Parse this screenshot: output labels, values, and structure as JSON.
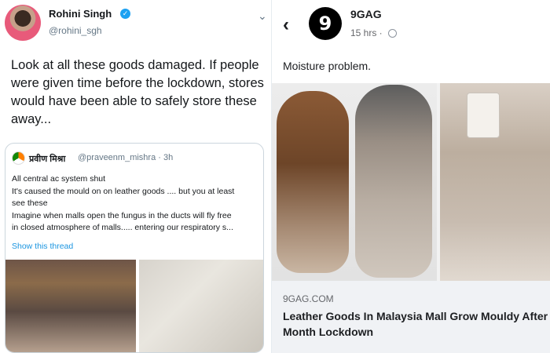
{
  "tweet": {
    "author_name": "Rohini Singh",
    "author_handle": "@rohini_sgh",
    "more_icon": "chevron-down-icon",
    "verified_icon": "verified-badge-icon",
    "text": "Look at all these goods damaged. If people were given time before the lockdown, stores would have been able to safely store these away...",
    "quote": {
      "author_name": "प्रवीण मिश्रा",
      "author_handle": "@praveenm_mishra · 3h",
      "lines": [
        "All central ac system shut",
        "It's caused the mould on on leather goods .... but you at least",
        "see these",
        "Imagine when malls open the fungus in the ducts will fly free",
        "in closed atmosphere of malls..... entering our respiratory s..."
      ],
      "show_thread": "Show this thread"
    }
  },
  "post": {
    "back_icon": "chevron-left-icon",
    "page_name": "9GAG",
    "page_logo": "9",
    "time": "15 hrs ·",
    "globe_icon": "globe-icon",
    "text": "Moisture problem.",
    "link": {
      "domain": "9GAG.COM",
      "title": "Leather Goods In Malaysia Mall Grow Mouldy After Month Lockdown"
    }
  },
  "colors": {
    "twitter_blue": "#1da1f2",
    "link_blue": "#1b95e0",
    "text_dark": "#14171a",
    "muted": "#657786"
  }
}
